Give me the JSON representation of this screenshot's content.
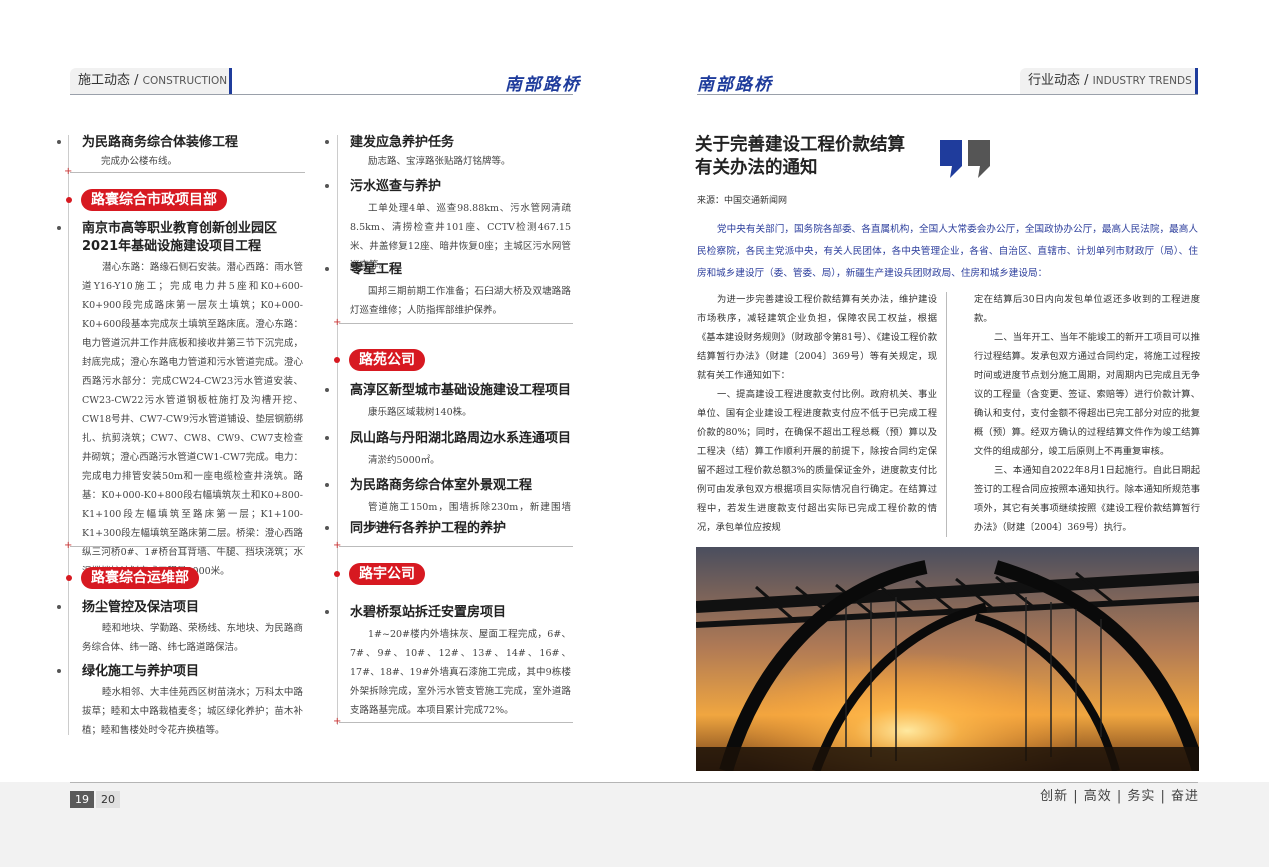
{
  "header": {
    "left_tab": {
      "cn": "施工动态 / ",
      "en": "CONSTRUCTION"
    },
    "left_brand": "南部路桥",
    "right_brand": "南部路桥",
    "right_tab": {
      "cn": "行业动态 / ",
      "en": "INDUSTRY TRENDS"
    }
  },
  "col1": {
    "item1": {
      "title": "为民路商务综合体装修工程",
      "text": "完成办公楼布线。"
    },
    "section1": {
      "badge": "路寰综合市政项目部"
    },
    "item2": {
      "title": "南京市高等职业教育创新创业园区2021年基础设施建设项目工程",
      "text": "潜心东路：路缘石侧石安装。潜心西路：雨水管道Y16-Y10施工；完成电力井5座和K0+600-K0+900段完成路床第一层灰土填筑；K0+000-K0+600段基本完成灰土填筑至路床底。澄心东路：电力管道沉井工作井底板和接收井第三节下沉完成，封底完成；澄心东路电力管道和污水管道完成。澄心西路污水部分：完成CW24-CW23污水管道安装、CW23-CW22污水管道钢板桩施打及沟槽开挖、CW18号井、CW7-CW9污水管道铺设、垫层钢筋绑扎、抗剪浇筑；CW7、CW8、CW9、CW7支检查井砌筑；澄心西路污水管道CW1-CW7完成。电力：完成电力排管安装50m和一座电缆检查井浇筑。路基：K0+000-K0+800段右幅填筑灰土和K0+800-K1+100段左幅填筑至路床第一层；K1+100-K1+300段左幅填筑至路床第二层。桥梁：澄心西路纵三河桥0#、1#桥台耳背墙、牛腿、挡块浇筑；水泥搅拌桩计划完成工程量9000米。"
    },
    "section2": {
      "badge": "路寰综合运维部"
    },
    "item3": {
      "title": "扬尘管控及保洁项目",
      "text": "睦和地块、学勤路、荣杨线、东地块、为民路商务综合体、纬一路、纬七路道路保洁。"
    },
    "item4": {
      "title": "绿化施工与养护项目",
      "text": "睦水相邻、大丰佳苑西区树苗浇水；万科太中路拔草；睦和太中路栽植麦冬；城区绿化养护；苗木补植；睦和售楼处时令花卉换植等。"
    }
  },
  "col2": {
    "item1": {
      "title": "建发应急养护任务",
      "text": "励志路、宝淳路张贴路灯铭牌等。"
    },
    "item2": {
      "title": "污水巡查与养护",
      "text": "工单处理4单、巡查98.88km、污水管网清疏8.5km、清捞检查井101座、CCTV检测467.15米、井盖修复12座、暗井恢复0座；主城区污水网管巡查等。"
    },
    "item3": {
      "title": "零星工程",
      "text": "国邦三期前期工作准备；石臼湖大桥及双塘路路灯巡查维修；人防指挥部维护保养。"
    },
    "section1": {
      "badge": "路苑公司"
    },
    "item4": {
      "title": "高淳区新型城市基础设施建设工程项目",
      "text": "康乐路区域栽树140株。"
    },
    "item5": {
      "title": "凤山路与丹阳湖北路周边水系连通项目",
      "text": "清淤约5000㎡。"
    },
    "item6": {
      "title": "为民路商务综合体室外景观工程",
      "text": "管道施工150m，围墙拆除230m，新建围墙100m。"
    },
    "item7": {
      "title": "同步进行各养护工程的养护",
      "text": ""
    },
    "section2": {
      "badge": "路宇公司"
    },
    "item8": {
      "title": "水碧桥泵站拆迁安置房项目",
      "text": "1#~20#楼内外墙抹灰、屋面工程完成，6#、7#、9#、10#、12#、13#、14#、16#、17#、18#、19#外墙真石漆施工完成，其中9栋楼外架拆除完成，室外污水管支管施工完成，室外道路支路路基完成。本项目累计完成72%。"
    }
  },
  "article": {
    "title_line1": "关于完善建设工程价款结算",
    "title_line2": "有关办法的通知",
    "source": "来源：中国交通新闻网",
    "address": "党中央有关部门，国务院各部委、各直属机构，全国人大常委会办公厅，全国政协办公厅，最高人民法院，最高人民检察院，各民主党派中央，有关人民团体，各中央管理企业，各省、自治区、直辖市、计划单列市财政厅（局）、住房和城乡建设厅（委、管委、局），新疆生产建设兵团财政局、住房和城乡建设局：",
    "p1": "为进一步完善建设工程价款结算有关办法，维护建设市场秩序，减轻建筑企业负担，保障农民工权益，根据《基本建设财务规则》（财政部令第81号）、《建设工程价款结算暂行办法》（财建〔2004〕369号）等有关规定，现就有关工作通知如下：",
    "p2": "一、提高建设工程进度款支付比例。政府机关、事业单位、国有企业建设工程进度款支付应不低于已完成工程价款的80%；同时，在确保不超出工程总概（预）算以及工程决（结）算工作顺利开展的前提下，除按合同约定保留不超过工程价款总额3%的质量保证金外，进度款支付比例可由发承包双方根据项目实际情况自行确定。在结算过程中，若发生进度款支付超出实际已完成工程价款的情况，承包单位应按规",
    "p3": "定在结算后30日内向发包单位返还多收到的工程进度款。",
    "p4": "二、当年开工、当年不能竣工的新开工项目可以推行过程结算。发承包双方通过合同约定，将施工过程按时间或进度节点划分施工周期，对周期内已完成且无争议的工程量（含变更、签证、索赔等）进行价款计算、确认和支付，支付金额不得超出已完工部分对应的批复概（预）算。经双方确认的过程结算文件作为竣工结算文件的组成部分，竣工后原则上不再重复审核。",
    "p5": "三、本通知自2022年8月1日起施行。自此日期起签订的工程合同应按照本通知执行。除本通知所规范事项外，其它有关事项继续按照《建设工程价款结算暂行办法》（财建〔2004〕369号）执行。"
  },
  "footer": {
    "page_left": "19",
    "page_right": "20",
    "slogan": "创新 | 高效 | 务实 | 奋进"
  },
  "colors": {
    "accent_blue": "#1f3c9c",
    "badge_red": "#d71921"
  }
}
